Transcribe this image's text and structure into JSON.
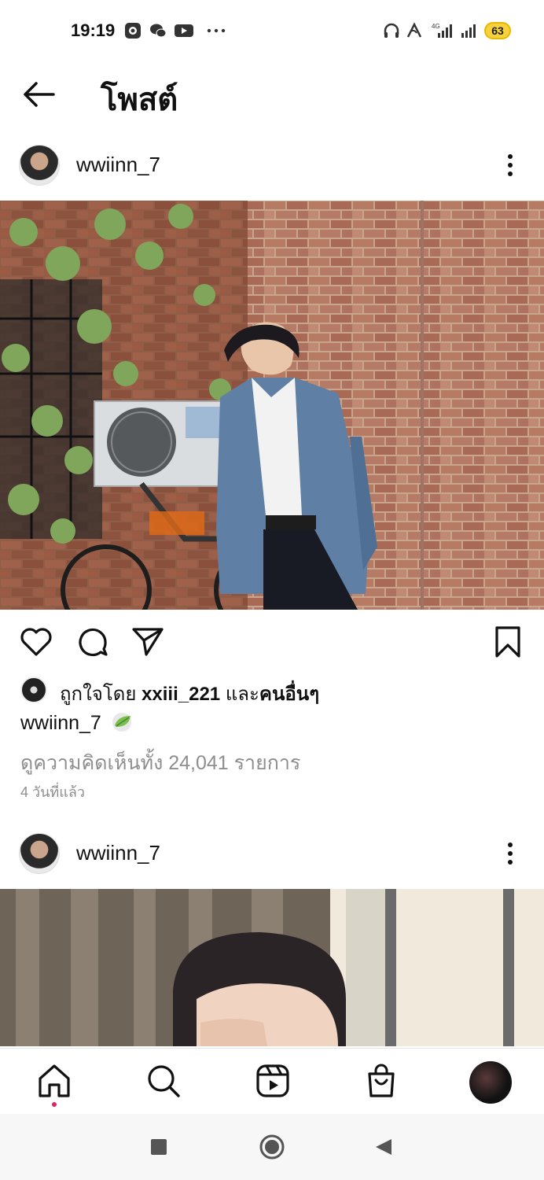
{
  "status": {
    "time": "19:19",
    "battery": "63"
  },
  "header": {
    "title": "โพสต์"
  },
  "post1": {
    "username": "wwiinn_7",
    "liked_prefix": "ถูกใจโดย",
    "liked_user": "xxiii_221",
    "liked_and": "และ",
    "liked_others": "คนอื่นๆ",
    "caption_user": "wwiinn_7",
    "comments": "ดูความคิดเห็นทั้ง 24,041 รายการ",
    "time_ago": "4 วันที่แล้ว"
  },
  "post2": {
    "username": "wwiinn_7"
  },
  "icons": {
    "status": [
      "camera-icon",
      "wechat-icon",
      "youtube-icon",
      "more-dots-icon",
      "headphones-icon",
      "signal-icon",
      "signal-icon"
    ],
    "actions": [
      "heart-icon",
      "comment-icon",
      "share-icon",
      "bookmark-icon"
    ],
    "nav": [
      "home-icon",
      "search-icon",
      "reels-icon",
      "shop-icon",
      "profile-avatar"
    ]
  }
}
